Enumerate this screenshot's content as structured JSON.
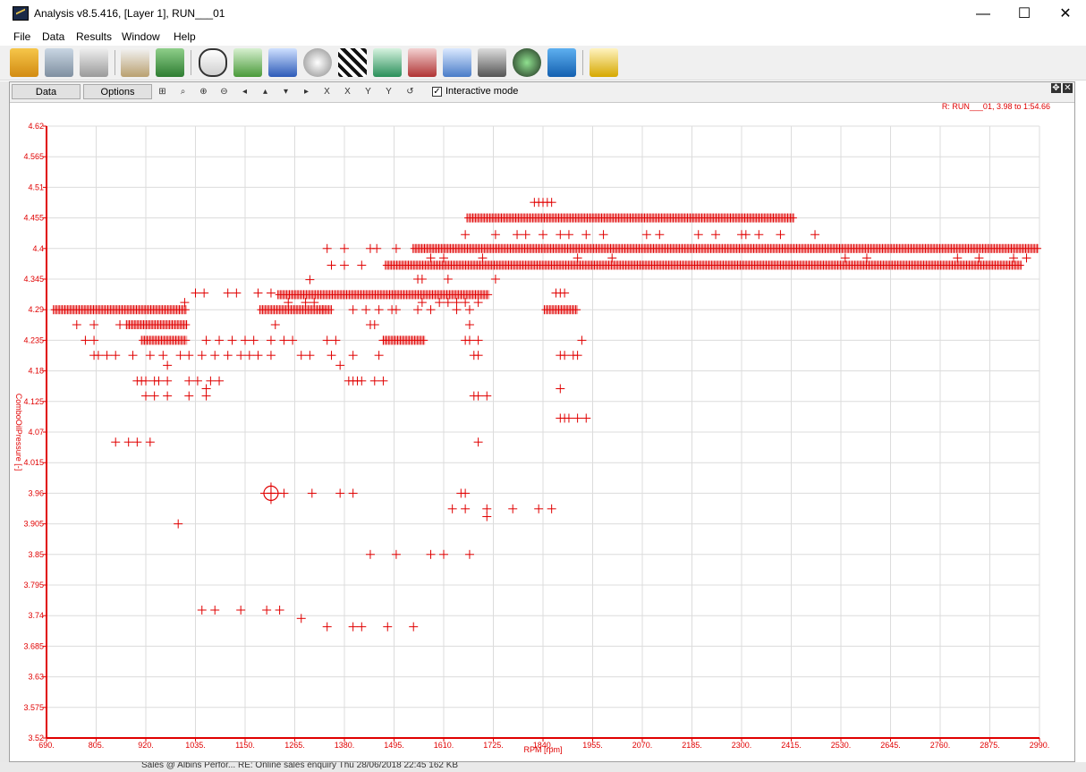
{
  "window": {
    "title": "Analysis v8.5.416, [Layer 1], RUN___01",
    "minimize": "—",
    "maximize": "☐",
    "close": "✕"
  },
  "menu": [
    "File",
    "Data",
    "Results",
    "Window",
    "Help"
  ],
  "toolbar_icons": [
    "open-folder-icon",
    "database-icon",
    "print-icon",
    "clipboard-icon",
    "xy-export-icon",
    "track-map-icon",
    "line-chart-icon",
    "bar-chart-icon",
    "stopwatch-icon",
    "checkered-flag-icon",
    "sigma-squared-icon",
    "calculator-icon",
    "xy-plot-icon",
    "video-camera-icon",
    "gauge-icon",
    "play-icon",
    "help-icon"
  ],
  "panel": {
    "tab_data": "Data",
    "tab_options": "Options",
    "interactive_label": "Interactive mode",
    "interactive_checked": true,
    "zoom_tools": [
      "zoom-box-icon",
      "zoom-select-icon",
      "zoom-in-icon",
      "zoom-out-icon",
      "pan-left-icon",
      "pan-up-icon",
      "pan-down-icon",
      "pan-right-icon",
      "x-zoom-in-icon",
      "x-zoom-out-icon",
      "y-zoom-in-icon",
      "y-zoom-out-icon",
      "zoom-reset-icon"
    ]
  },
  "status_strip": "Sales @ Albins Perfor...   RE: Online sales enquiry          Thu 28/06/2018 22:45        162 KB",
  "chart_data": {
    "type": "scatter",
    "annotation": "R:  RUN___01, 3.98 to 1:54.66",
    "xlabel": "RPM [rpm]",
    "ylabel": "ComboOilPressure [-]",
    "xlim": [
      690,
      2990
    ],
    "ylim": [
      3.52,
      4.62
    ],
    "xticks": [
      "690.",
      "805.",
      "920.",
      "1035.",
      "1150.",
      "1265.",
      "1380.",
      "1495.",
      "1610.",
      "1725.",
      "1840.",
      "1955.",
      "2070.",
      "2185.",
      "2300.",
      "2415.",
      "2530.",
      "2645.",
      "2760.",
      "2875.",
      "2990."
    ],
    "yticks": [
      "3.52",
      "3.575",
      "3.63",
      "3.685",
      "3.74",
      "3.795",
      "3.85",
      "3.905",
      "3.96",
      "4.015",
      "4.07",
      "4.125",
      "4.18",
      "4.235",
      "4.29",
      "4.345",
      "4.4",
      "4.455",
      "4.51",
      "4.565",
      "4.62"
    ],
    "grid": true,
    "marker": "+",
    "color": "#e00000",
    "cursor": {
      "x": 1210,
      "y": 3.96
    },
    "dense_runs": [
      {
        "y": 4.455,
        "x_from": 1664,
        "x_to": 2422
      },
      {
        "y": 4.4,
        "x_from": 1539,
        "x_to": 2988
      },
      {
        "y": 4.37,
        "x_from": 1475,
        "x_to": 2948
      },
      {
        "y": 4.317,
        "x_from": 1226,
        "x_to": 1716
      },
      {
        "y": 4.29,
        "x_from": 706,
        "x_to": 1015
      },
      {
        "y": 4.29,
        "x_from": 1184,
        "x_to": 1350
      },
      {
        "y": 4.29,
        "x_from": 1843,
        "x_to": 1921
      },
      {
        "y": 4.263,
        "x_from": 875,
        "x_to": 1016
      },
      {
        "y": 4.235,
        "x_from": 910,
        "x_to": 1016
      },
      {
        "y": 4.235,
        "x_from": 1470,
        "x_to": 1567
      }
    ],
    "points": [
      [
        1820,
        4.483
      ],
      [
        1830,
        4.483
      ],
      [
        1840,
        4.483
      ],
      [
        1850,
        4.483
      ],
      [
        1860,
        4.483
      ],
      [
        1660,
        4.425
      ],
      [
        1730,
        4.425
      ],
      [
        1780,
        4.425
      ],
      [
        1800,
        4.425
      ],
      [
        1840,
        4.425
      ],
      [
        1880,
        4.425
      ],
      [
        1900,
        4.425
      ],
      [
        1940,
        4.425
      ],
      [
        1980,
        4.425
      ],
      [
        2080,
        4.425
      ],
      [
        2110,
        4.425
      ],
      [
        2200,
        4.425
      ],
      [
        2240,
        4.425
      ],
      [
        2300,
        4.425
      ],
      [
        2310,
        4.425
      ],
      [
        2340,
        4.425
      ],
      [
        2390,
        4.425
      ],
      [
        2470,
        4.425
      ],
      [
        1340,
        4.4
      ],
      [
        1380,
        4.4
      ],
      [
        1440,
        4.4
      ],
      [
        1455,
        4.4
      ],
      [
        1500,
        4.4
      ],
      [
        1580,
        4.383
      ],
      [
        1610,
        4.383
      ],
      [
        1700,
        4.383
      ],
      [
        1920,
        4.383
      ],
      [
        2000,
        4.383
      ],
      [
        2540,
        4.383
      ],
      [
        2590,
        4.383
      ],
      [
        2800,
        4.383
      ],
      [
        2850,
        4.383
      ],
      [
        2930,
        4.383
      ],
      [
        2960,
        4.383
      ],
      [
        1350,
        4.37
      ],
      [
        1380,
        4.37
      ],
      [
        1420,
        4.37
      ],
      [
        1550,
        4.345
      ],
      [
        1560,
        4.345
      ],
      [
        1620,
        4.345
      ],
      [
        1730,
        4.345
      ],
      [
        1300,
        4.344
      ],
      [
        1035,
        4.32
      ],
      [
        1055,
        4.32
      ],
      [
        1110,
        4.32
      ],
      [
        1130,
        4.32
      ],
      [
        1180,
        4.32
      ],
      [
        1210,
        4.32
      ],
      [
        1010,
        4.303
      ],
      [
        1250,
        4.303
      ],
      [
        1290,
        4.303
      ],
      [
        1310,
        4.303
      ],
      [
        1330,
        4.29
      ],
      [
        1400,
        4.29
      ],
      [
        1430,
        4.29
      ],
      [
        1460,
        4.29
      ],
      [
        1490,
        4.29
      ],
      [
        1500,
        4.29
      ],
      [
        1550,
        4.29
      ],
      [
        1580,
        4.29
      ],
      [
        1640,
        4.29
      ],
      [
        1670,
        4.29
      ],
      [
        1560,
        4.303
      ],
      [
        1600,
        4.303
      ],
      [
        1620,
        4.303
      ],
      [
        1640,
        4.303
      ],
      [
        1660,
        4.303
      ],
      [
        1690,
        4.303
      ],
      [
        1870,
        4.32
      ],
      [
        1880,
        4.32
      ],
      [
        1890,
        4.32
      ],
      [
        760,
        4.263
      ],
      [
        800,
        4.263
      ],
      [
        860,
        4.263
      ],
      [
        1220,
        4.263
      ],
      [
        1440,
        4.263
      ],
      [
        1450,
        4.263
      ],
      [
        1670,
        4.263
      ],
      [
        780,
        4.235
      ],
      [
        800,
        4.235
      ],
      [
        1060,
        4.235
      ],
      [
        1090,
        4.235
      ],
      [
        1120,
        4.235
      ],
      [
        1150,
        4.235
      ],
      [
        1170,
        4.235
      ],
      [
        1210,
        4.235
      ],
      [
        1240,
        4.235
      ],
      [
        1260,
        4.235
      ],
      [
        1340,
        4.235
      ],
      [
        1360,
        4.235
      ],
      [
        1470,
        4.235
      ],
      [
        1660,
        4.235
      ],
      [
        1670,
        4.235
      ],
      [
        1690,
        4.235
      ],
      [
        1930,
        4.235
      ],
      [
        800,
        4.208
      ],
      [
        810,
        4.208
      ],
      [
        830,
        4.208
      ],
      [
        850,
        4.208
      ],
      [
        890,
        4.208
      ],
      [
        930,
        4.208
      ],
      [
        960,
        4.208
      ],
      [
        1000,
        4.208
      ],
      [
        1020,
        4.208
      ],
      [
        1050,
        4.208
      ],
      [
        1080,
        4.208
      ],
      [
        1110,
        4.208
      ],
      [
        1140,
        4.208
      ],
      [
        1160,
        4.208
      ],
      [
        1180,
        4.208
      ],
      [
        1210,
        4.208
      ],
      [
        1280,
        4.208
      ],
      [
        1300,
        4.208
      ],
      [
        1350,
        4.208
      ],
      [
        1400,
        4.208
      ],
      [
        1460,
        4.208
      ],
      [
        1680,
        4.208
      ],
      [
        1690,
        4.208
      ],
      [
        1880,
        4.208
      ],
      [
        1890,
        4.208
      ],
      [
        1910,
        4.208
      ],
      [
        1920,
        4.208
      ],
      [
        1370,
        4.19
      ],
      [
        970,
        4.19
      ],
      [
        900,
        4.162
      ],
      [
        910,
        4.162
      ],
      [
        920,
        4.162
      ],
      [
        940,
        4.162
      ],
      [
        950,
        4.162
      ],
      [
        970,
        4.162
      ],
      [
        1020,
        4.162
      ],
      [
        1040,
        4.162
      ],
      [
        1070,
        4.162
      ],
      [
        1090,
        4.162
      ],
      [
        1390,
        4.162
      ],
      [
        1400,
        4.162
      ],
      [
        1410,
        4.162
      ],
      [
        1420,
        4.162
      ],
      [
        1450,
        4.162
      ],
      [
        1470,
        4.162
      ],
      [
        1060,
        4.148
      ],
      [
        1880,
        4.148
      ],
      [
        920,
        4.135
      ],
      [
        940,
        4.135
      ],
      [
        970,
        4.135
      ],
      [
        1020,
        4.135
      ],
      [
        1060,
        4.135
      ],
      [
        1680,
        4.135
      ],
      [
        1690,
        4.135
      ],
      [
        1710,
        4.135
      ],
      [
        1880,
        4.095
      ],
      [
        1890,
        4.095
      ],
      [
        1900,
        4.095
      ],
      [
        1920,
        4.095
      ],
      [
        1940,
        4.095
      ],
      [
        850,
        4.052
      ],
      [
        880,
        4.052
      ],
      [
        900,
        4.052
      ],
      [
        930,
        4.052
      ],
      [
        1690,
        4.052
      ],
      [
        1210,
        3.96
      ],
      [
        1240,
        3.96
      ],
      [
        1305,
        3.96
      ],
      [
        1370,
        3.96
      ],
      [
        1400,
        3.96
      ],
      [
        1650,
        3.96
      ],
      [
        1660,
        3.96
      ],
      [
        1630,
        3.932
      ],
      [
        1660,
        3.932
      ],
      [
        1710,
        3.932
      ],
      [
        1770,
        3.932
      ],
      [
        1830,
        3.932
      ],
      [
        1860,
        3.932
      ],
      [
        1710,
        3.918
      ],
      [
        995,
        3.905
      ],
      [
        1440,
        3.85
      ],
      [
        1500,
        3.85
      ],
      [
        1580,
        3.85
      ],
      [
        1610,
        3.85
      ],
      [
        1670,
        3.85
      ],
      [
        1050,
        3.75
      ],
      [
        1080,
        3.75
      ],
      [
        1140,
        3.75
      ],
      [
        1200,
        3.75
      ],
      [
        1230,
        3.75
      ],
      [
        1280,
        3.735
      ],
      [
        1340,
        3.72
      ],
      [
        1400,
        3.72
      ],
      [
        1420,
        3.72
      ],
      [
        1480,
        3.72
      ],
      [
        1540,
        3.72
      ]
    ]
  }
}
